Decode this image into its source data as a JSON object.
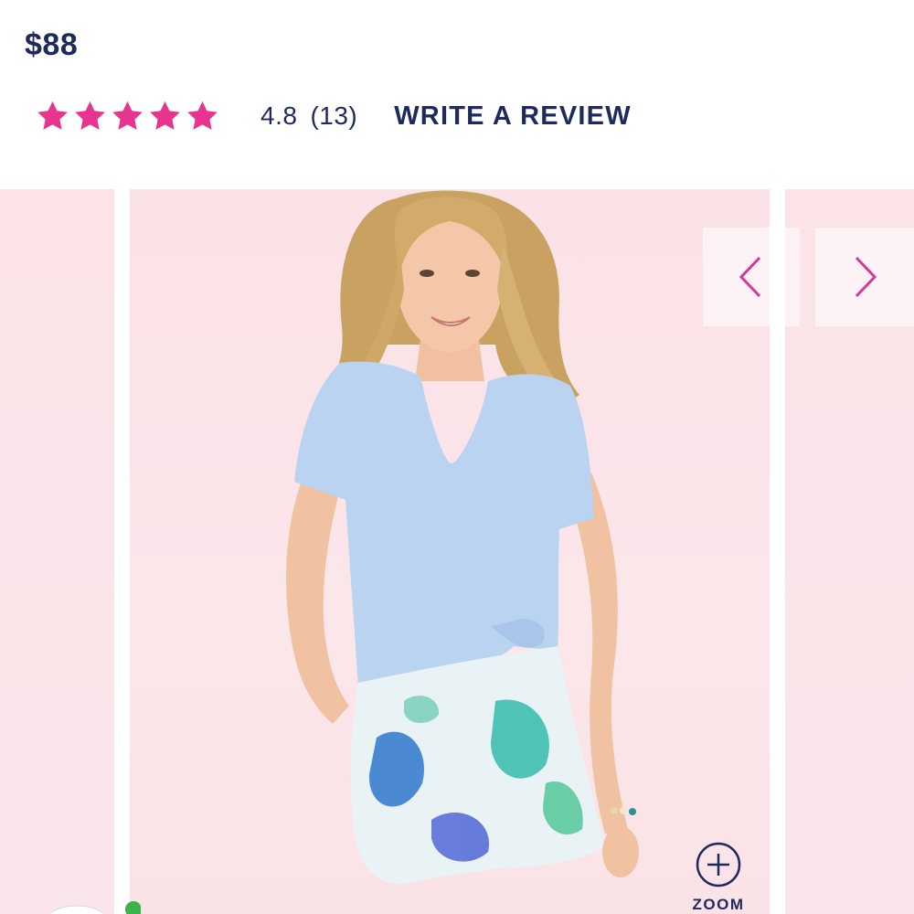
{
  "product": {
    "price": "$88",
    "rating": {
      "stars": 5,
      "value": "4.8",
      "count": "(13)",
      "star_color": "#e6348f"
    },
    "write_review_label": "WRITE A REVIEW"
  },
  "gallery": {
    "prev_icon": "chevron-left-icon",
    "next_icon": "chevron-right-icon",
    "arrow_color": "#d6379a",
    "zoom_label": "ZOOM",
    "background": "#fbe3e8"
  },
  "colors": {
    "text": "#1f2a5c",
    "accent": "#e6348f"
  }
}
